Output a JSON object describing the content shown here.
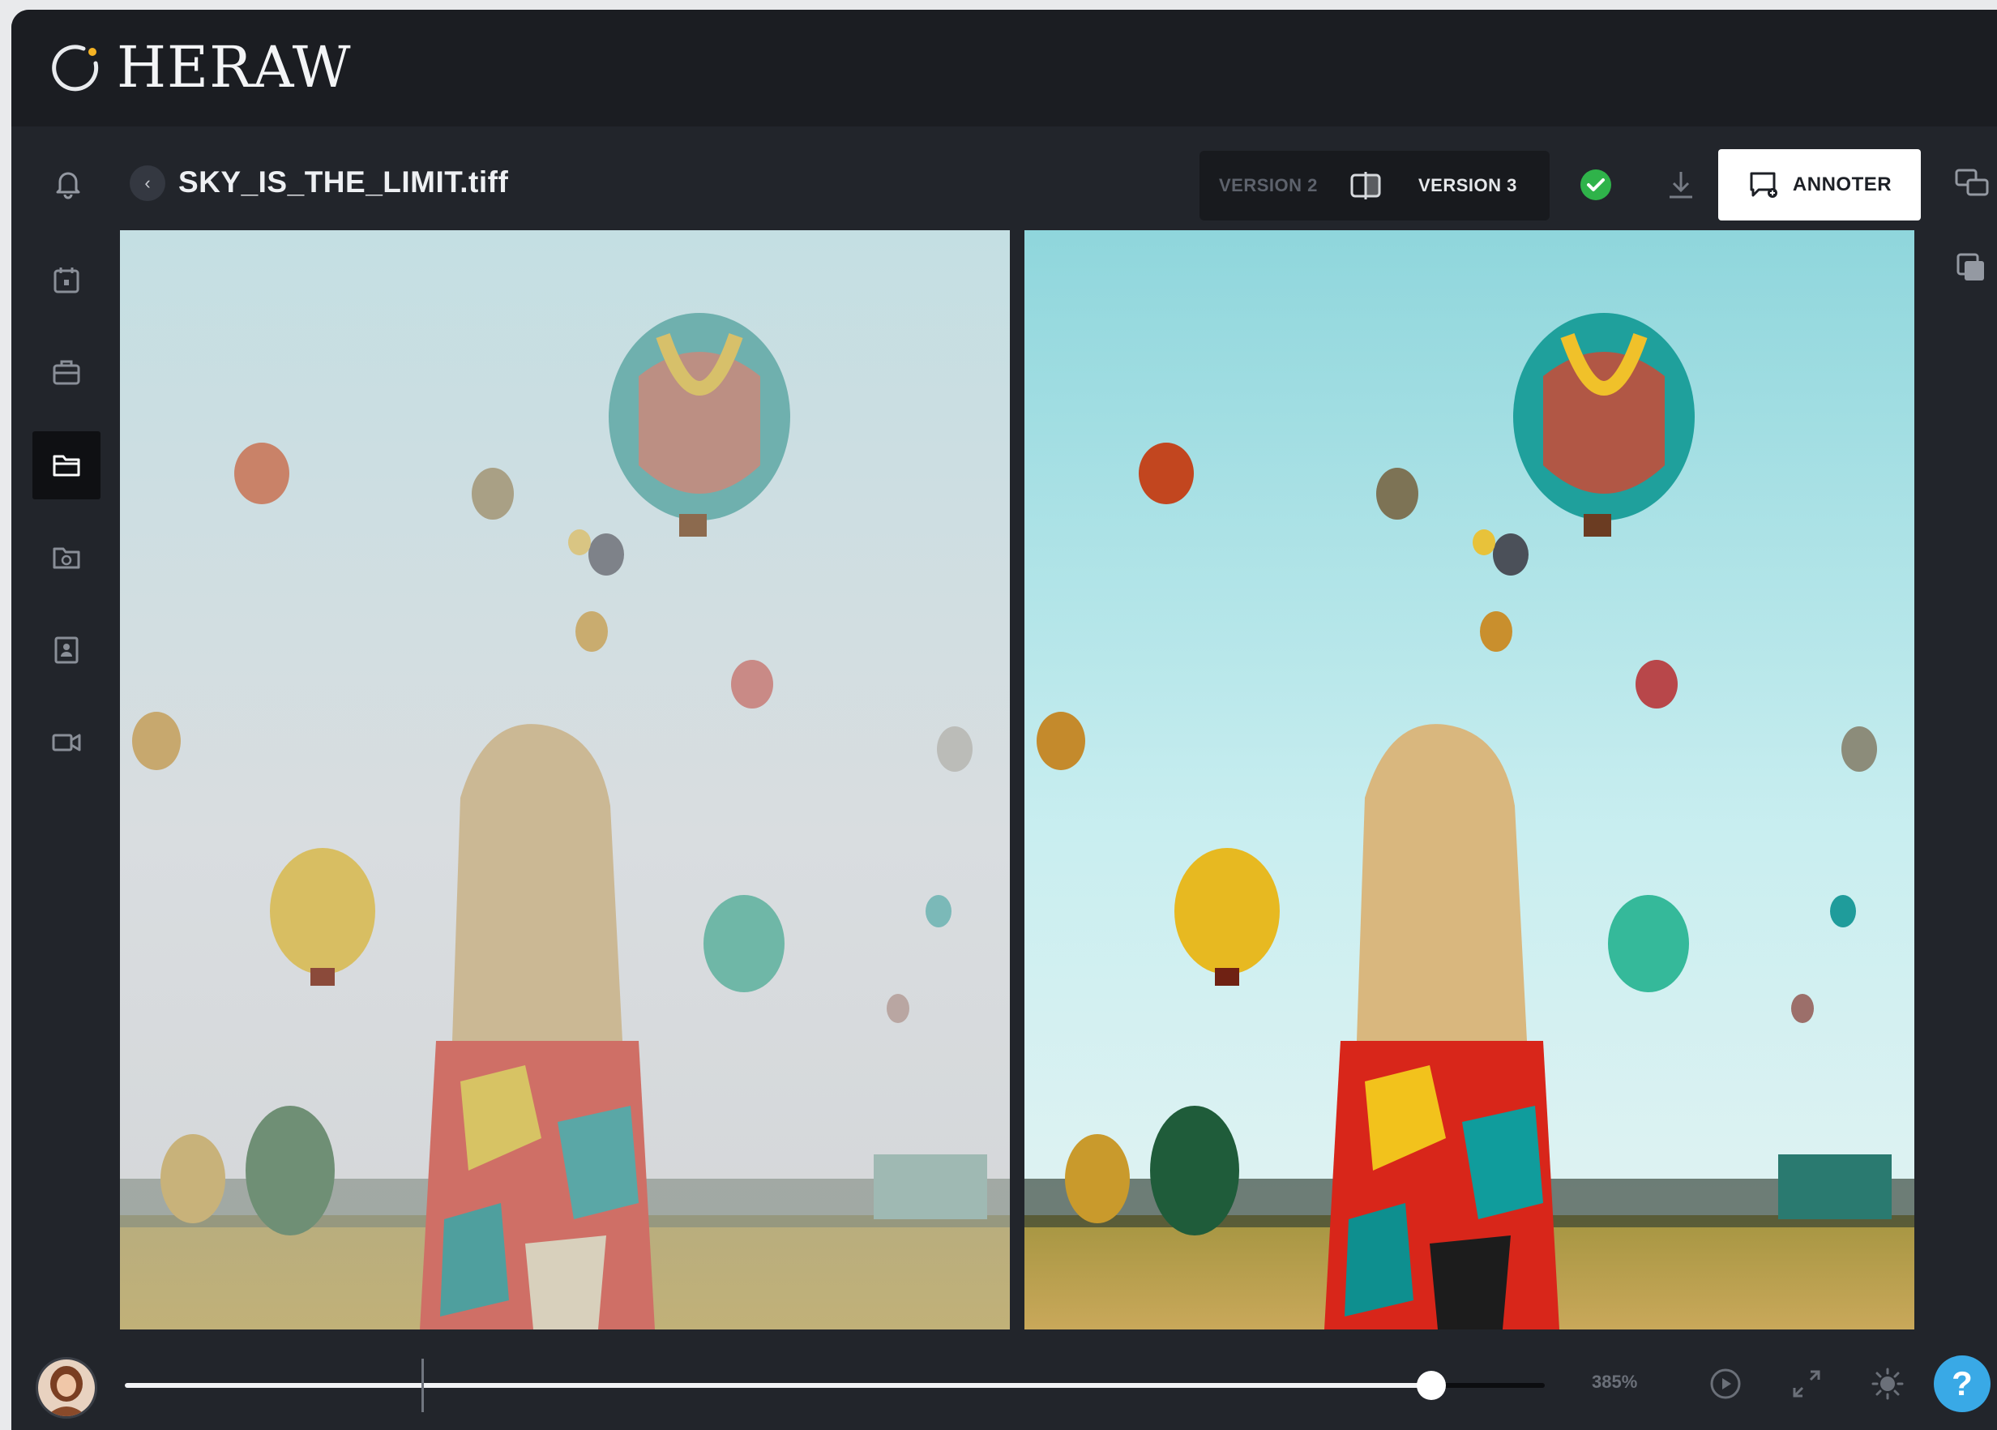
{
  "app": {
    "name": "HERAW",
    "logo_icon": "heraw-ring-logo"
  },
  "toolbar": {
    "notifications_icon": "bell-icon",
    "back_icon": "chevron-left-icon",
    "back_glyph": "‹",
    "filename": "SKY_IS_THE_LIMIT.tiff",
    "version_left": "VERSION 2",
    "version_right": "VERSION 3",
    "compare_icon": "split-compare-icon",
    "approved_icon": "check-circle-icon",
    "approved_color": "#2fb34a",
    "download_icon": "download-icon",
    "annotate_label": "ANNOTER",
    "annotate_icon": "annotate-comment-icon",
    "chat_icon": "chat-bubbles-icon"
  },
  "sidebar": {
    "items": [
      {
        "icon": "calendar-icon",
        "active": false
      },
      {
        "icon": "briefcase-icon",
        "active": false
      },
      {
        "icon": "folder-icon",
        "active": true
      },
      {
        "icon": "folder-clock-icon",
        "active": false
      },
      {
        "icon": "contact-book-icon",
        "active": false
      },
      {
        "icon": "video-camera-icon",
        "active": false
      }
    ]
  },
  "right_panel": {
    "icon": "copy-layers-icon"
  },
  "viewers": [
    {
      "version": "VERSION 2",
      "image": "hot-air-balloons-faded"
    },
    {
      "version": "VERSION 3",
      "image": "hot-air-balloons-vivid"
    }
  ],
  "bottombar": {
    "avatar_icon": "user-avatar",
    "timeline_progress": 0.92,
    "zoom_label": "385%",
    "play_icon": "play-circle-icon",
    "fullscreen_icon": "fullscreen-icon",
    "settings_icon": "settings-sun-icon",
    "help_label": "?",
    "help_color": "#39a9e6"
  }
}
